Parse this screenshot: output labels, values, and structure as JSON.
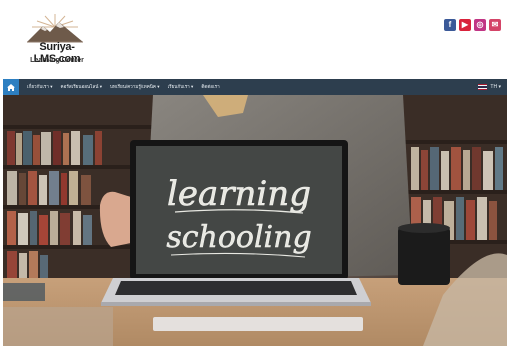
{
  "brand": {
    "title": "Suriya-LMS.com",
    "subtitle": "Learning Center"
  },
  "social": [
    {
      "icon": "facebook-icon",
      "glyph": "f",
      "color": "#3b5998"
    },
    {
      "icon": "youtube-icon",
      "glyph": "▶",
      "color": "#d9223b"
    },
    {
      "icon": "instagram-icon",
      "glyph": "◎",
      "color": "#c13584"
    },
    {
      "icon": "mail-icon",
      "glyph": "✉",
      "color": "#d44468"
    }
  ],
  "nav": {
    "home_icon": "home-icon",
    "items": [
      "เกี่ยวกับเรา ▾",
      "คอร์สเรียนออนไลน์ ▾",
      "บทเรียน/ความรู้/เทคนิค ▾",
      "เรียนกับเรา ▾",
      "ติดต่อเรา"
    ],
    "language": "TH ▾"
  },
  "hero": {
    "chalk_line1": "learning",
    "chalk_line2": "schooling"
  },
  "colors": {
    "nav_bg": "#2d3e4e",
    "home_btn": "#2d7fc1"
  }
}
